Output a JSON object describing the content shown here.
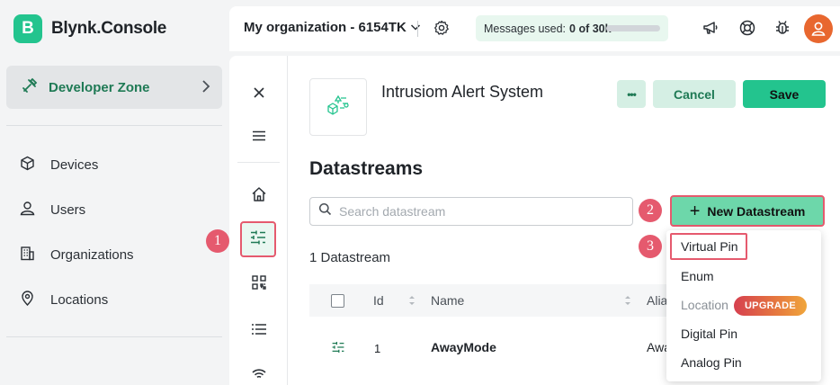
{
  "app": {
    "logo_letter": "B",
    "name": "Blynk.Console",
    "brand_color": "#23c48e",
    "marker_color": "#e55a6e"
  },
  "sidebar": {
    "developer_zone": {
      "label": "Developer Zone",
      "icon": "tools-icon"
    },
    "items": [
      {
        "label": "Devices",
        "icon": "cube-icon"
      },
      {
        "label": "Users",
        "icon": "user-icon"
      },
      {
        "label": "Organizations",
        "icon": "building-icon"
      },
      {
        "label": "Locations",
        "icon": "pin-icon"
      }
    ]
  },
  "header": {
    "org_name": "My organization - 6154TK",
    "messages_label": "Messages used:",
    "messages_value": "0 of 30k",
    "messages_used_fraction": 0,
    "icons": [
      "settings-icon",
      "megaphone-icon",
      "help-lifebuoy-icon",
      "bug-icon",
      "avatar"
    ]
  },
  "toolbar": {
    "icons": [
      "close-icon",
      "menu-icon",
      "home-icon",
      "datastreams-icon",
      "qr-grid-icon",
      "list-icon",
      "wifi-icon"
    ],
    "active": "datastreams-icon"
  },
  "template": {
    "title": "Intrusiom Alert System",
    "more_label": "•••",
    "cancel_label": "Cancel",
    "save_label": "Save"
  },
  "datastreams": {
    "title": "Datastreams",
    "search_placeholder": "Search datastream",
    "new_button_label": "New Datastream",
    "count_label": "1 Datastream",
    "columns": [
      "Id",
      "Name",
      "Alia"
    ],
    "rows": [
      {
        "id": "1",
        "name": "AwayMode",
        "alias": "Awa"
      }
    ]
  },
  "dropdown": {
    "items": [
      {
        "label": "Virtual Pin",
        "highlighted": true
      },
      {
        "label": "Enum"
      },
      {
        "label": "Location",
        "disabled": true,
        "badge": "UPGRADE"
      },
      {
        "label": "Digital Pin"
      },
      {
        "label": "Analog Pin"
      }
    ]
  },
  "markers": [
    "1",
    "2",
    "3"
  ]
}
